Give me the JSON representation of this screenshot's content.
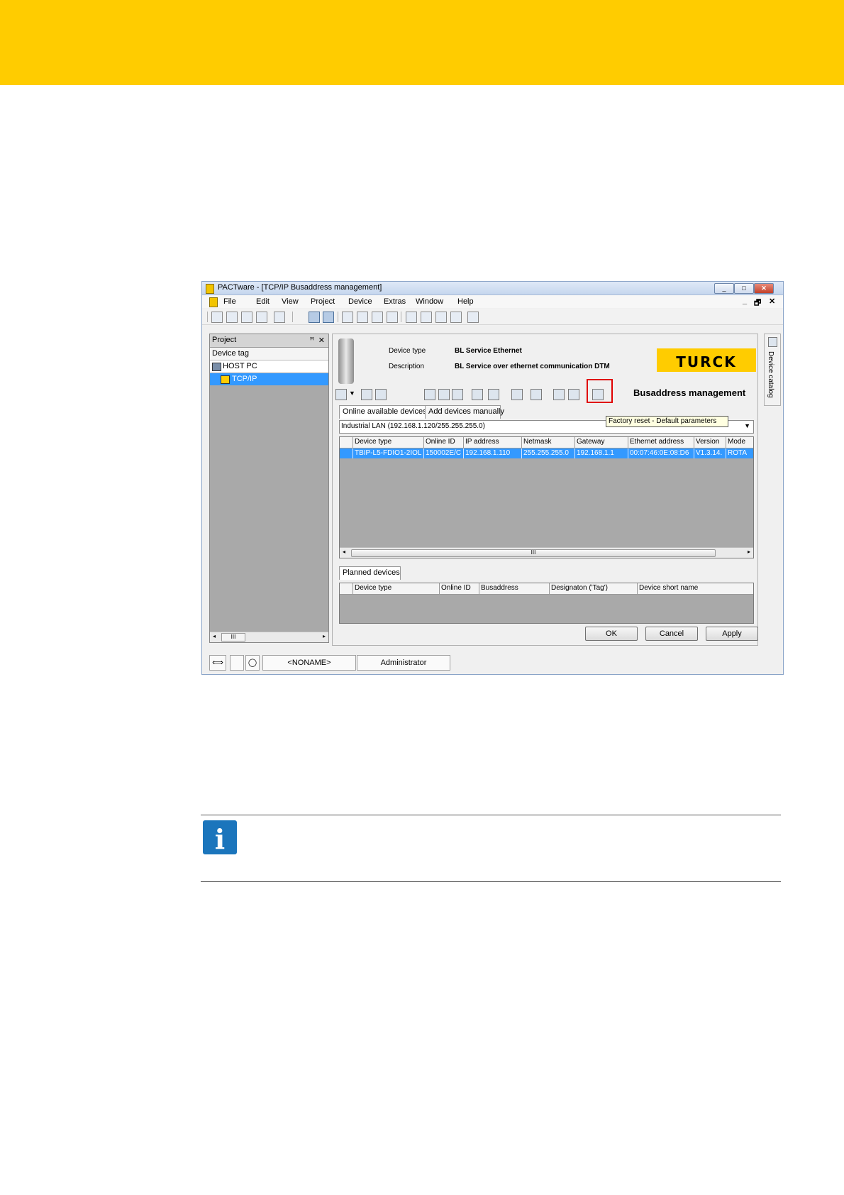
{
  "window": {
    "title": "PACTware - [TCP/IP Busaddress management]",
    "controls": [
      "_",
      "□",
      "✕"
    ]
  },
  "menu": {
    "items": [
      "File",
      "Edit",
      "View",
      "Project",
      "Device",
      "Extras",
      "Window",
      "Help"
    ],
    "mdi_controls": [
      "_",
      "🗗",
      "✕"
    ]
  },
  "project_pane": {
    "title": "Project",
    "column": "Device tag",
    "tree": [
      "HOST PC",
      "TCP/IP"
    ],
    "scroll_label": "III"
  },
  "device_info": {
    "type_label": "Device type",
    "type_value": "BL Service Ethernet",
    "description_label": "Description",
    "description_value": "BL Service over ethernet communication DTM",
    "brand": "TURCK",
    "section_title": "Busaddress management"
  },
  "tooltip": "Factory reset - Default parameters",
  "tabs": [
    "Online available devices",
    "Add devices manually"
  ],
  "network_select": "Industrial LAN (192.168.1.120/255.255.255.0)",
  "online_grid": {
    "columns": [
      "Device type",
      "Online ID",
      "IP address",
      "Netmask",
      "Gateway",
      "Ethernet address",
      "Version",
      "Mode"
    ],
    "rows": [
      [
        "TBIP-L5-FDIO1-2IOL",
        "150002E/C",
        "192.168.1.110",
        "255.255.255.0",
        "192.168.1.1",
        "00:07:46:0E:08:D6",
        "V1.3.14.",
        "ROTA"
      ]
    ],
    "scroll_label": "III"
  },
  "planned_tab": "Planned devices",
  "planned_grid": {
    "columns": [
      "Device type",
      "Online ID",
      "Busaddress",
      "Designaton ('Tag')",
      "Device short name"
    ]
  },
  "buttons": {
    "ok": "OK",
    "cancel": "Cancel",
    "apply": "Apply"
  },
  "side_tab": "Device catalog",
  "statusbar": {
    "project": "<NONAME>",
    "user": "Administrator"
  },
  "info_icon": "i",
  "colors": {
    "band": "#ffcc00",
    "selection": "#3399ff",
    "highlight": "#e00000",
    "info": "#1b75bc"
  }
}
